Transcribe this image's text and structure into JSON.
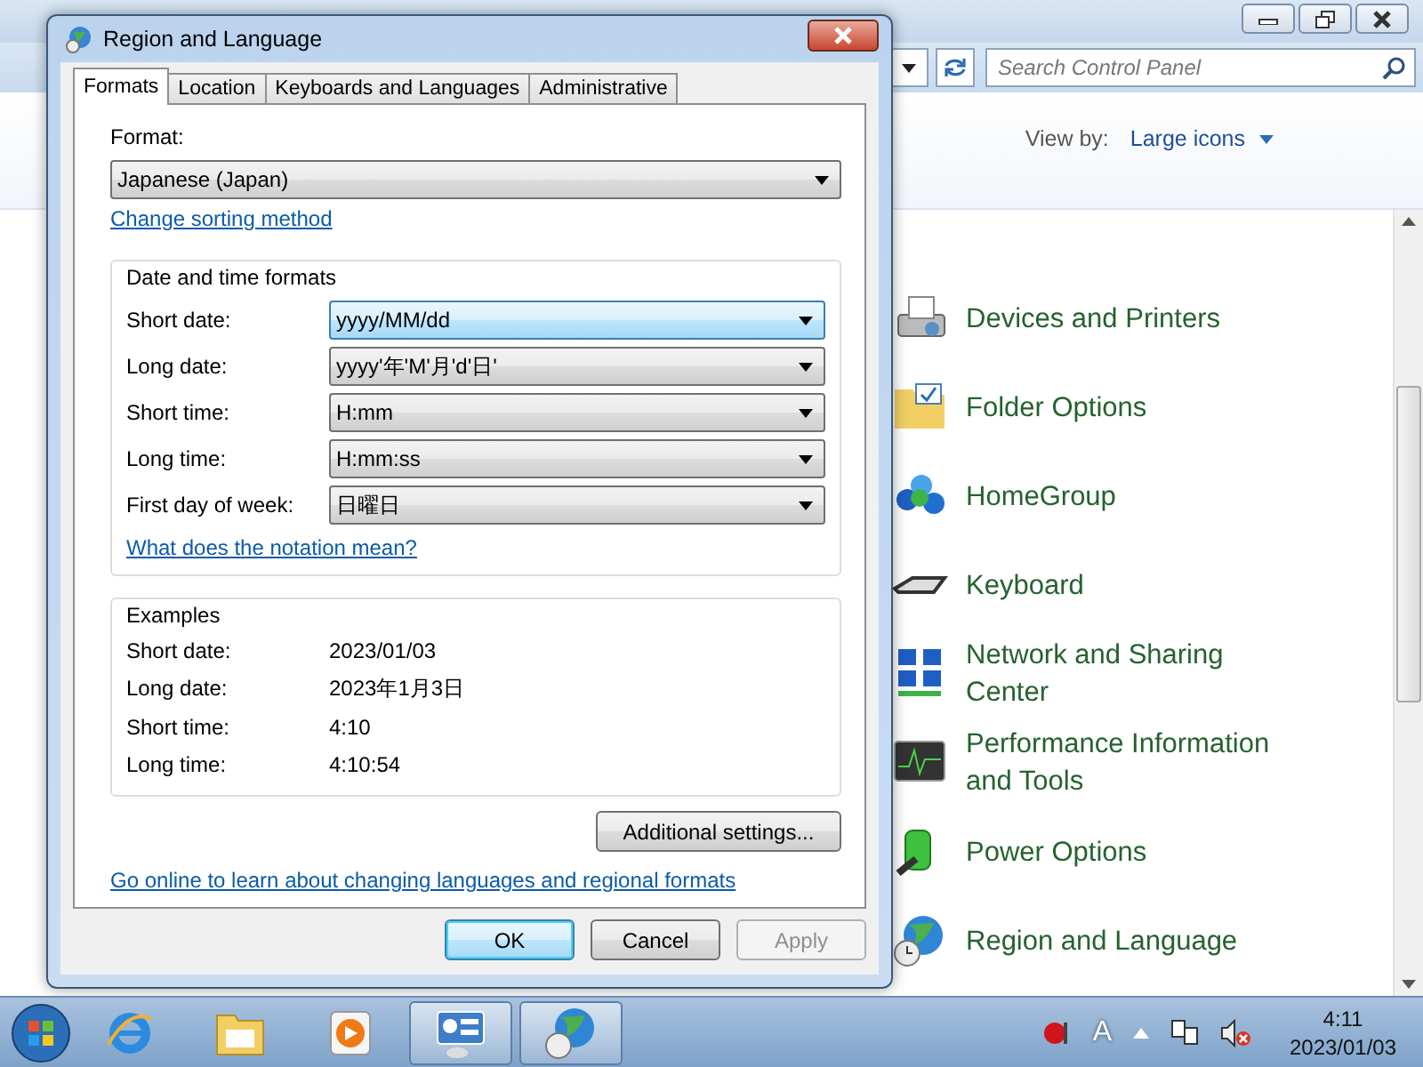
{
  "control_panel": {
    "search": {
      "placeholder": "Search Control Panel"
    },
    "view_by": {
      "label": "View by:",
      "value": "Large icons"
    },
    "items": [
      {
        "label": "Devices and Printers"
      },
      {
        "label": "Folder Options"
      },
      {
        "label": "HomeGroup"
      },
      {
        "label": "Keyboard"
      },
      {
        "label": "Network and Sharing Center"
      },
      {
        "label": "Performance Information and Tools"
      },
      {
        "label": "Power Options"
      },
      {
        "label": "Region and Language"
      }
    ]
  },
  "dialog": {
    "title": "Region and Language",
    "tabs": [
      {
        "label": "Formats",
        "selected": true
      },
      {
        "label": "Location",
        "selected": false
      },
      {
        "label": "Keyboards and Languages",
        "selected": false
      },
      {
        "label": "Administrative",
        "selected": false
      }
    ],
    "format": {
      "label": "Format:",
      "value": "Japanese (Japan)"
    },
    "sorting_link": "Change sorting method",
    "date_time": {
      "title": "Date and time formats",
      "fields": [
        {
          "label": "Short date:",
          "value": "yyyy/MM/dd",
          "focused": true
        },
        {
          "label": "Long date:",
          "value": "yyyy'年'M'月'd'日'",
          "focused": false
        },
        {
          "label": "Short time:",
          "value": "H:mm",
          "focused": false
        },
        {
          "label": "Long time:",
          "value": "H:mm:ss",
          "focused": false
        },
        {
          "label": "First day of week:",
          "value": "日曜日",
          "focused": false
        }
      ],
      "link": "What does the notation mean?"
    },
    "examples": {
      "title": "Examples",
      "rows": [
        {
          "label": "Short date:",
          "value": "2023/01/03"
        },
        {
          "label": "Long date:",
          "value": "2023年1月3日"
        },
        {
          "label": "Short time:",
          "value": "4:10"
        },
        {
          "label": "Long time:",
          "value": "4:10:54"
        }
      ]
    },
    "additional_button": "Additional settings...",
    "online_link": "Go online to learn about changing languages and regional formats",
    "buttons": [
      {
        "label": "OK",
        "default": true,
        "disabled": false
      },
      {
        "label": "Cancel",
        "default": false,
        "disabled": false
      },
      {
        "label": "Apply",
        "default": false,
        "disabled": true
      }
    ]
  },
  "taskbar": {
    "apps": [
      {
        "selected": false
      },
      {
        "selected": false
      },
      {
        "selected": false
      },
      {
        "selected": true
      },
      {
        "selected": true
      }
    ],
    "tray": {
      "ime": "A",
      "time": "4:11",
      "date": "2023/01/03"
    }
  }
}
